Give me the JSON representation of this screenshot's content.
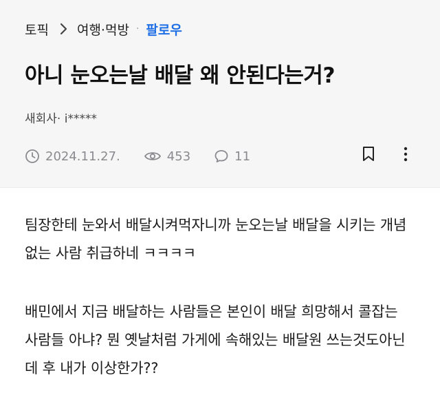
{
  "breadcrumb": {
    "topic": "토픽",
    "category": "여행·먹방",
    "separator": "·",
    "follow": "팔로우"
  },
  "post": {
    "title": "아니 눈오는날 배달 왜 안된다는거?",
    "author": "새회사· i*****",
    "date": "2024.11.27.",
    "views": "453",
    "comments": "11",
    "paragraphs": [
      "팀장한테 눈와서 배달시켜먹자니까 눈오는날 배달을 시키는 개념없는 사람 취급하네 ㅋㅋㅋㅋ",
      "배민에서 지금 배달하는 사람들은 본인이 배달 희망해서 콜잡는 사람들 아냐? 뭔 옛날처럼 가게에 속해있는 배달원 쓰는것도아닌데 후 내가 이상한가??"
    ]
  },
  "icons": {
    "clock": "clock-icon",
    "eye": "eye-icon",
    "comment": "comment-icon",
    "bookmark": "bookmark-icon",
    "more": "more-vertical-icon"
  },
  "colors": {
    "accent": "#1f6fe5",
    "header_bg": "#f6f6f7",
    "meta_text": "#8a8a8f"
  }
}
